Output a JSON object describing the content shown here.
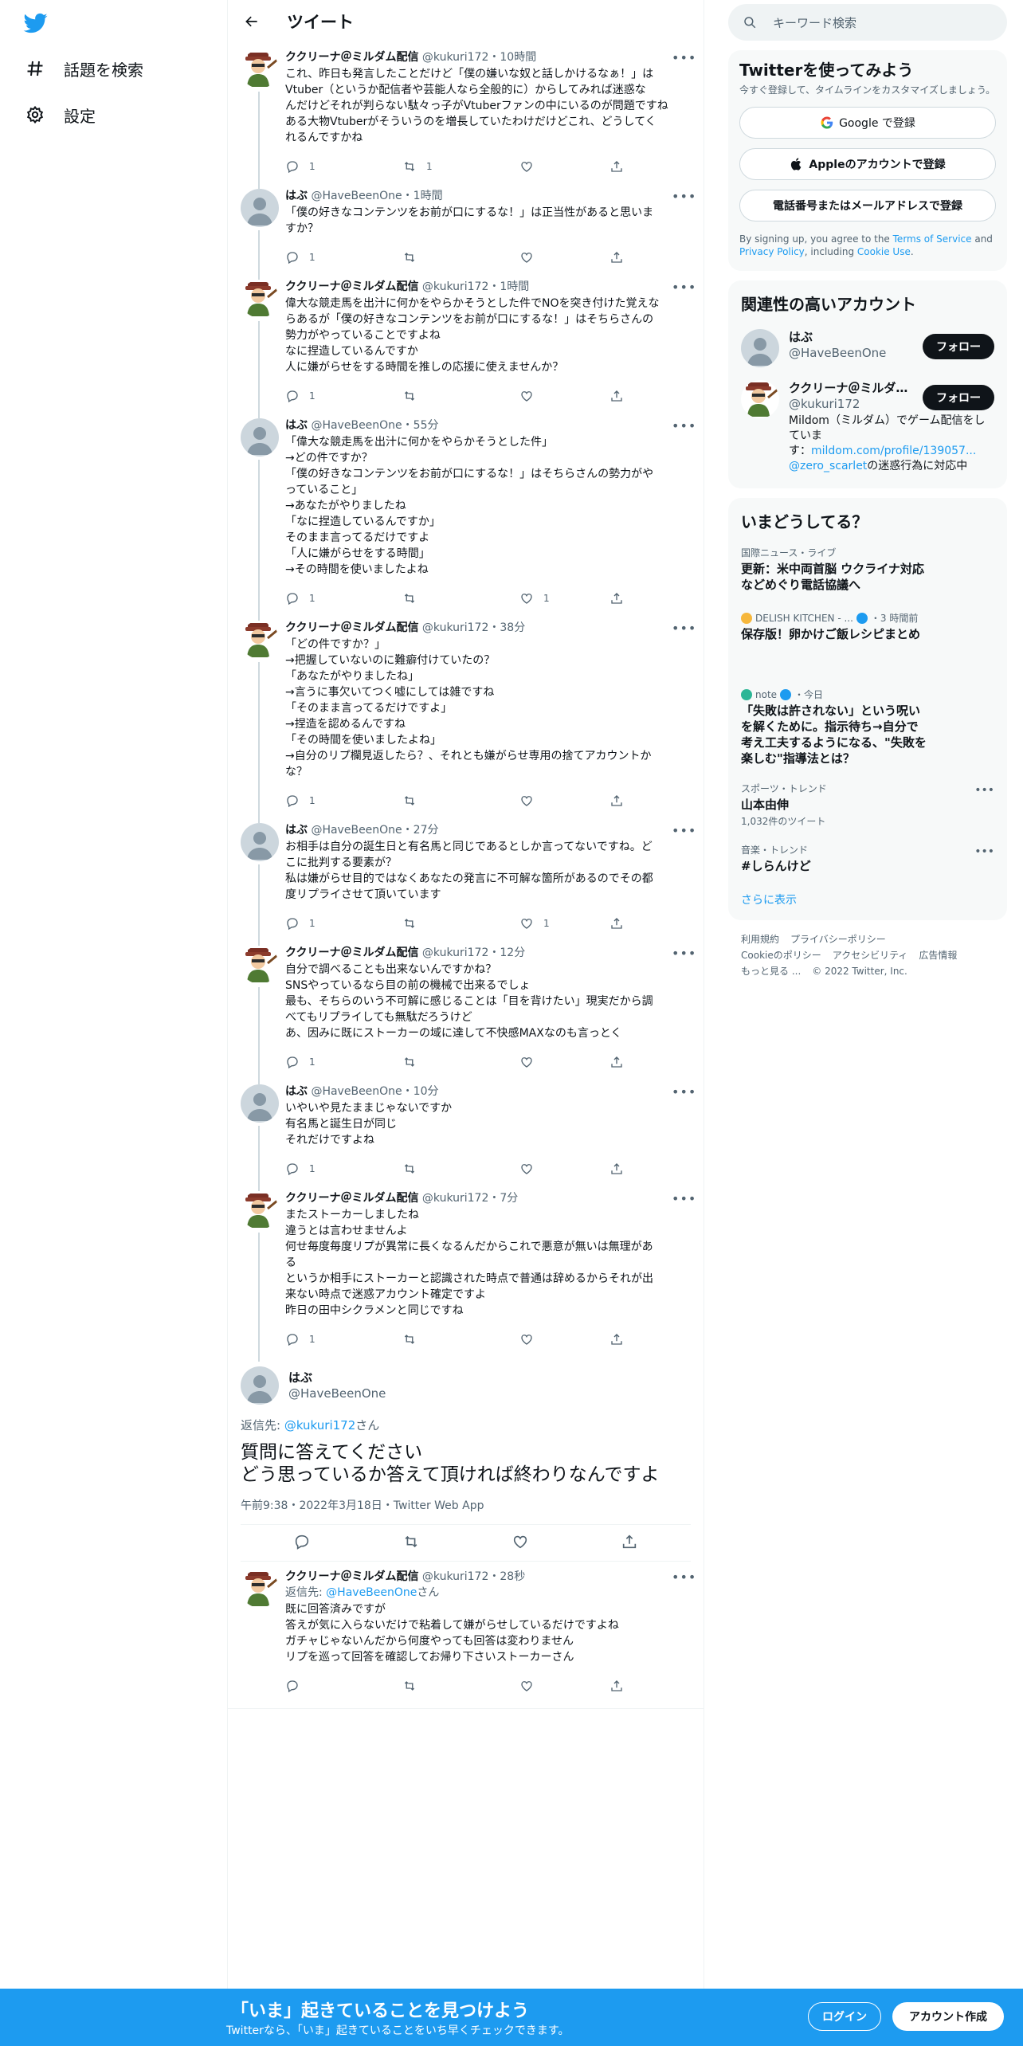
{
  "nav": {
    "explore_label": "話題を検索",
    "settings_label": "設定"
  },
  "header": {
    "title": "ツイート"
  },
  "tweets": [
    {
      "name": "ククリーナ＠ミルダム配信",
      "handle": "@kukuri172",
      "time": "10時間",
      "text": "これ、昨日も発言したことだけど「僕の嫌いな奴と話しかけるなぁ！」は\nVtuber（というか配信者や芸能人なら全般的に）からしてみれば迷惑な\nんだけどそれが判らない駄々っ子がVtuberファンの中にいるのが問題ですね\nある大物Vtuberがそういうのを増長していたわけだけどこれ、どうしてく\nれるんですかね",
      "reply": "1",
      "retweet": "1",
      "like": ""
    },
    {
      "name": "はぶ",
      "handle": "@HaveBeenOne",
      "time": "1時間",
      "text": "「僕の好きなコンテンツをお前が口にするな！」は正当性があると思いま\nすか？",
      "reply": "1",
      "retweet": "",
      "like": ""
    },
    {
      "name": "ククリーナ＠ミルダム配信",
      "handle": "@kukuri172",
      "time": "1時間",
      "text": "偉大な競走馬を出汁に何かをやらかそうとした件でNOを突き付けた覚えな\nらあるが「僕の好きなコンテンツをお前が口にするな！」はそちらさんの\n勢力がやっていることですよね\nなに捏造しているんですか\n人に嫌がらせをする時間を推しの応援に使えませんか？",
      "reply": "1",
      "retweet": "",
      "like": ""
    },
    {
      "name": "はぶ",
      "handle": "@HaveBeenOne",
      "time": "55分",
      "text": "「偉大な競走馬を出汁に何かをやらかそうとした件」\n→どの件ですか？\n「僕の好きなコンテンツをお前が口にするな！」はそちらさんの勢力がや\nっていること」\n→あなたがやりましたね\n「なに捏造しているんですか」\nそのまま言ってるだけですよ\n「人に嫌がらせをする時間」\n→その時間を使いましたよね",
      "reply": "1",
      "retweet": "",
      "like": "1"
    },
    {
      "name": "ククリーナ＠ミルダム配信",
      "handle": "@kukuri172",
      "time": "38分",
      "text": "「どの件ですか？」\n→把握していないのに難癖付けていたの？\n「あなたがやりましたね」\n→言うに事欠いてつく嘘にしては雑ですね\n「そのまま言ってるだけですよ」\n→捏造を認めるんですね\n「その時間を使いましたよね」\n→自分のリプ欄見返したら？、それとも嫌がらせ専用の捨てアカウントか\nな？",
      "reply": "1",
      "retweet": "",
      "like": ""
    },
    {
      "name": "はぶ",
      "handle": "@HaveBeenOne",
      "time": "27分",
      "text": "お相手は自分の誕生日と有名馬と同じであるとしか言ってないですね。ど\nこに批判する要素が？\n私は嫌がらせ目的ではなくあなたの発言に不可解な箇所があるのでその都\n度リプライさせて頂いています",
      "reply": "1",
      "retweet": "",
      "like": "1"
    },
    {
      "name": "ククリーナ＠ミルダム配信",
      "handle": "@kukuri172",
      "time": "12分",
      "text": "自分で調べることも出来ないんですかね？\nSNSやっているなら目の前の機械で出来るでしょ\n最も、そちらのいう不可解に感じることは「目を背けたい」現実だから調\nべてもリプライしても無駄だろうけど\nあ、因みに既にストーカーの域に達して不快感MAXなのも言っとく",
      "reply": "1",
      "retweet": "",
      "like": ""
    },
    {
      "name": "はぶ",
      "handle": "@HaveBeenOne",
      "time": "10分",
      "text": "いやいや見たままじゃないですか\n有名馬と誕生日が同じ\nそれだけですよね",
      "reply": "1",
      "retweet": "",
      "like": ""
    },
    {
      "name": "ククリーナ＠ミルダム配信",
      "handle": "@kukuri172",
      "time": "7分",
      "text": "またストーカーしましたね\n違うとは言わせませんよ\n何せ毎度毎度リプが異常に長くなるんだからこれで悪意が無いは無理があ\nる\nというか相手にストーカーと認識された時点で普通は辞めるからそれが出\n来ない時点で迷惑アカウント確定ですよ\n昨日の田中シクラメンと同じですね",
      "reply": "1",
      "retweet": "",
      "like": ""
    }
  ],
  "focus": {
    "name": "はぶ",
    "handle": "@HaveBeenOne",
    "replyto_prefix": "返信先: ",
    "replyto_user": "@kukuri172",
    "replyto_suffix": "さん",
    "text": "質問に答えてください\nどう思っているか答えて頂ければ終わりなんですよ",
    "meta": "午前9:38・2022年3月18日・Twitter Web App"
  },
  "reply": {
    "name": "ククリーナ＠ミルダム配信",
    "handle": "@kukuri172",
    "time": "28秒",
    "replyto_prefix": "返信先: ",
    "replyto_user": "@HaveBeenOne",
    "replyto_suffix": "さん",
    "text": "既に回答済みですが\n答えが気に入らないだけで粘着して嫌がらせしているだけですよね\nガチャじゃないんだから何度やっても回答は変わりません\nリプを巡って回答を確認してお帰り下さいストーカーさん"
  },
  "search": {
    "placeholder": "キーワード検索"
  },
  "signup_card": {
    "title": "Twitterを使ってみよう",
    "sub": "今すぐ登録して、タイムラインをカスタマイズしましょう。",
    "google": "Google で登録",
    "apple": "Appleのアカウントで登録",
    "phone": "電話番号またはメールアドレスで登録",
    "legal_1": "By signing up, you agree to the ",
    "legal_tos": "Terms of Service",
    "legal_2": " and ",
    "legal_privacy": "Privacy Policy",
    "legal_3": ", including ",
    "legal_cookie": "Cookie Use",
    "legal_4": "."
  },
  "related": {
    "title": "関連性の高いアカウント",
    "follow": "フォロー",
    "accounts": [
      {
        "name": "はぶ",
        "handle": "@HaveBeenOne"
      },
      {
        "name": "ククリーナ＠ミルダム配信",
        "handle": "@kukuri172",
        "bio_1": "Mildom（ミルダム）でゲーム配信をしていま\nす：",
        "bio_link": "mildom.com/profile/139057...",
        "bio_mention": "@zero_scarlet",
        "bio_2": "の迷惑行為に対応中"
      }
    ]
  },
  "trends": {
    "title": "いまどうしてる？",
    "items": [
      {
        "meta": "国際ニュース・ライブ",
        "title": "更新：米中両首脳 ウクライナ対応\nなどめぐり電話協議へ"
      },
      {
        "meta_src": "DELISH KITCHEN - ...",
        "meta_time": "・3 時間前",
        "title": "保存版！卵かけご飯レシピまとめ"
      },
      {
        "meta_src": "note",
        "meta_time": "・今日",
        "title": "「失敗は許されない」という呪い\nを解くために。指示待ち→自分で\n考え工夫するようになる、\"失敗を\n楽しむ\"指導法とは？"
      },
      {
        "meta": "スポーツ・トレンド",
        "title": "山本由伸",
        "count": "1,032件のツイート"
      },
      {
        "meta": "音楽・トレンド",
        "title": "#しらんけど"
      }
    ],
    "show_more": "さらに表示"
  },
  "footer": {
    "items": [
      "利用規約",
      "プライバシーポリシー",
      "Cookieのポリシー",
      "アクセシビリティ",
      "広告情報",
      "もっと見る ...",
      "© 2022 Twitter, Inc."
    ]
  },
  "bottom_bar": {
    "title": "「いま」起きていることを見つけよう",
    "sub": "Twitterなら、「いま」起きていることをいち早くチェックできます。",
    "login": "ログイン",
    "signup": "アカウント作成"
  },
  "colors": {
    "accent": "#1d9bf0",
    "text": "#0f1419",
    "secondary": "#536471"
  }
}
